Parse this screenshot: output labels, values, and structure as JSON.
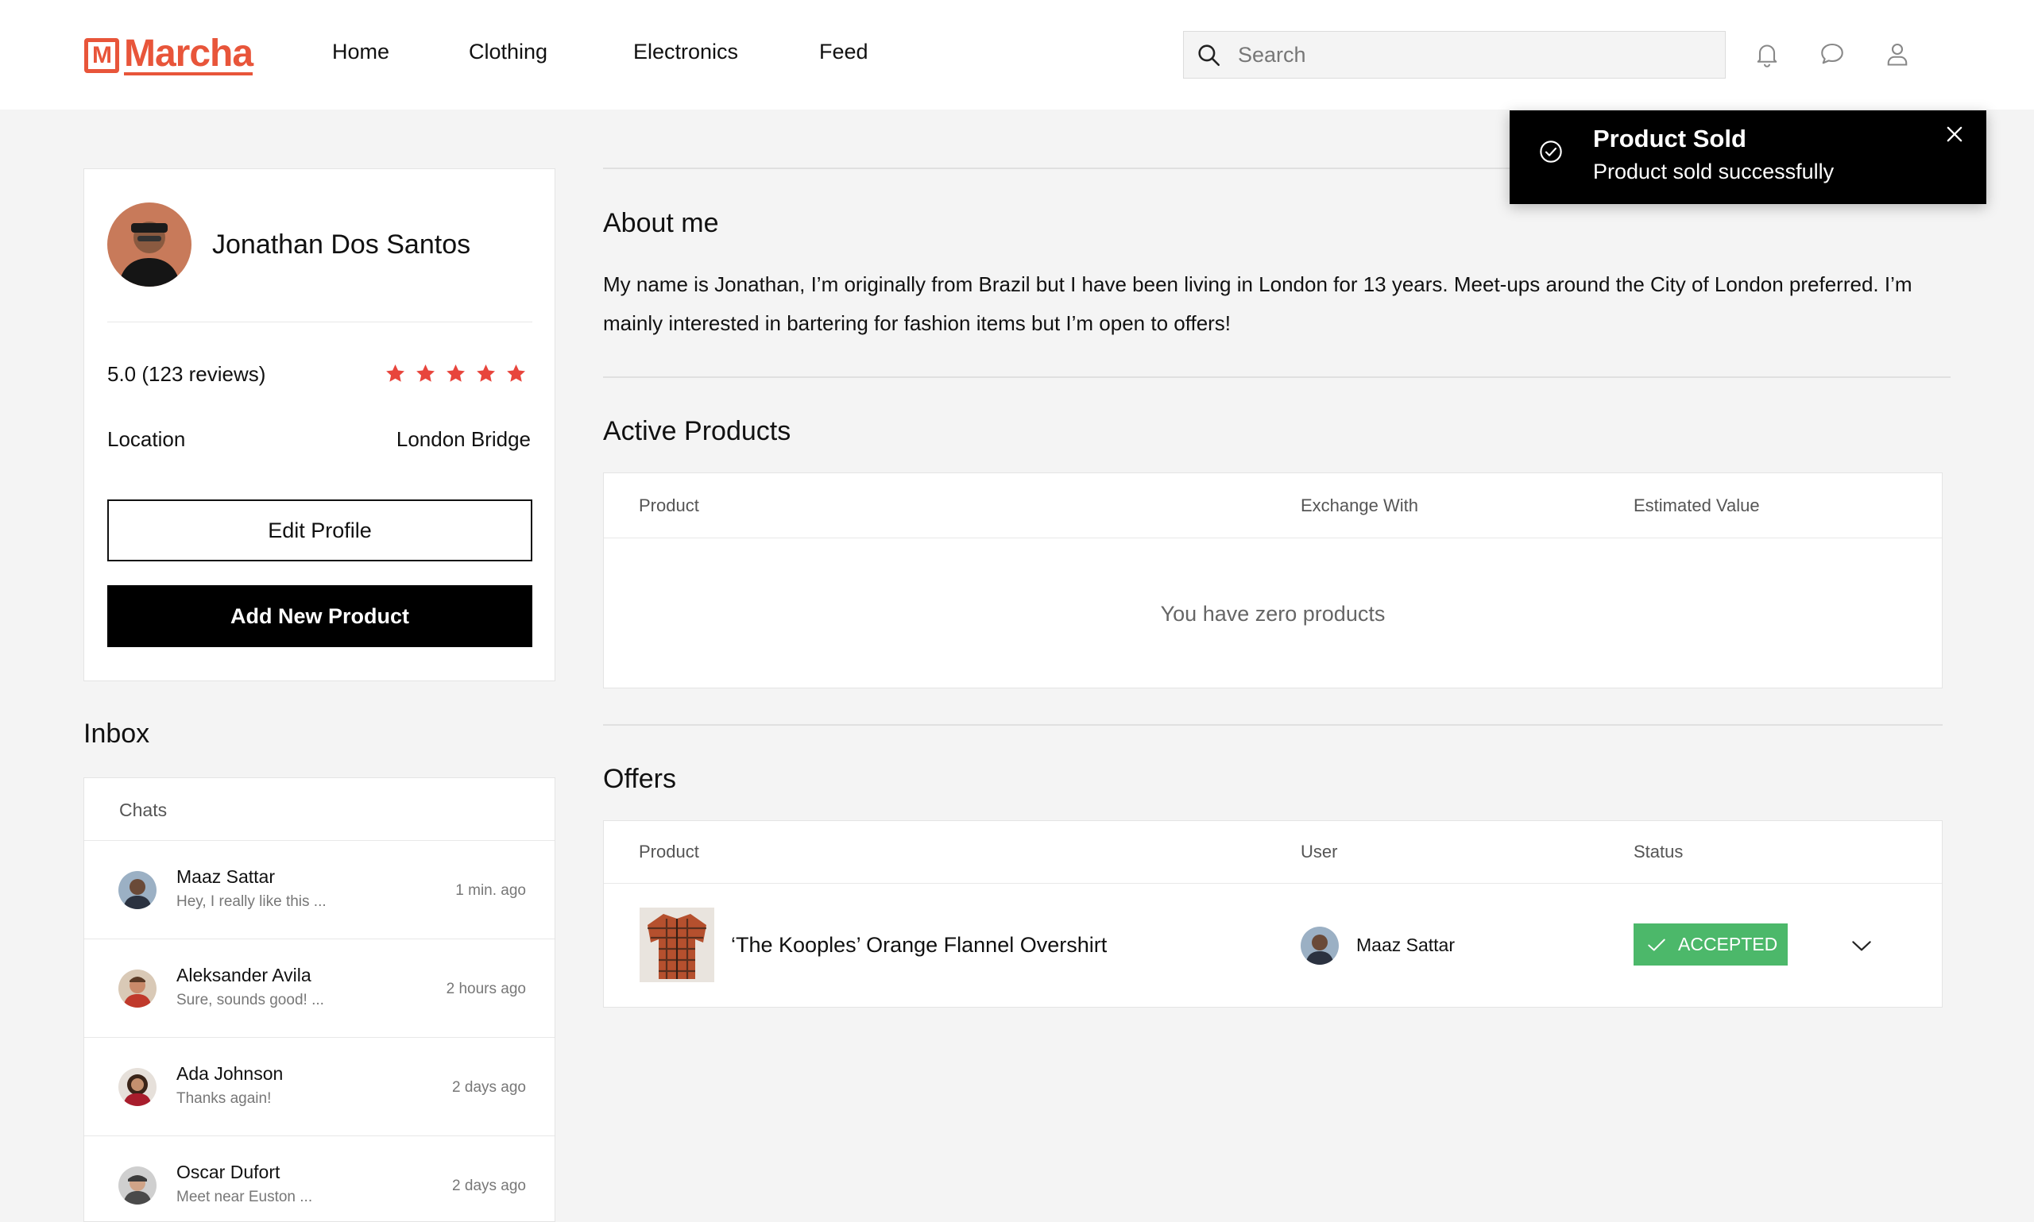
{
  "brand": {
    "logo_mark": "M",
    "name": "Marcha",
    "color": "#e8553a"
  },
  "nav": [
    {
      "label": "Home"
    },
    {
      "label": "Clothing"
    },
    {
      "label": "Electronics"
    },
    {
      "label": "Feed"
    }
  ],
  "search": {
    "placeholder": "Search",
    "value": ""
  },
  "header_icons": [
    "bell-icon",
    "chat-bubble-icon",
    "user-icon"
  ],
  "toast": {
    "title": "Product Sold",
    "message": "Product sold successfully",
    "icon": "check-circle-icon"
  },
  "profile": {
    "name": "Jonathan Dos Santos",
    "rating_text": "5.0 (123 reviews)",
    "rating": 5,
    "rating_max": 5,
    "star_color": "#e8453c",
    "location_label": "Location",
    "location_value": "London Bridge",
    "edit_button": "Edit Profile",
    "add_button": "Add New Product"
  },
  "inbox": {
    "title": "Inbox",
    "header": "Chats",
    "chats": [
      {
        "name": "Maaz Sattar",
        "message": "Hey, I really like this ...",
        "time": "1 min. ago"
      },
      {
        "name": "Aleksander Avila",
        "message": "Sure, sounds good! ...",
        "time": "2 hours ago"
      },
      {
        "name": "Ada Johnson",
        "message": "Thanks again!",
        "time": "2 days ago"
      },
      {
        "name": "Oscar Dufort",
        "message": "Meet near Euston ...",
        "time": "2 days ago"
      }
    ]
  },
  "about": {
    "title": "About me",
    "text": "My name is Jonathan, I’m originally from Brazil but I have been living in London for 13 years. Meet-ups around the City of London preferred. I’m mainly interested in bartering for fashion items but I’m open to offers!"
  },
  "active_products": {
    "title": "Active Products",
    "columns": [
      "Product",
      "Exchange With",
      "Estimated Value"
    ],
    "empty_message": "You have zero products"
  },
  "offers": {
    "title": "Offers",
    "columns": [
      "Product",
      "User",
      "Status"
    ],
    "rows": [
      {
        "product": "‘The Kooples’ Orange Flannel Overshirt",
        "user": "Maaz Sattar",
        "status": "ACCEPTED",
        "status_color": "#4cb86a"
      }
    ]
  }
}
